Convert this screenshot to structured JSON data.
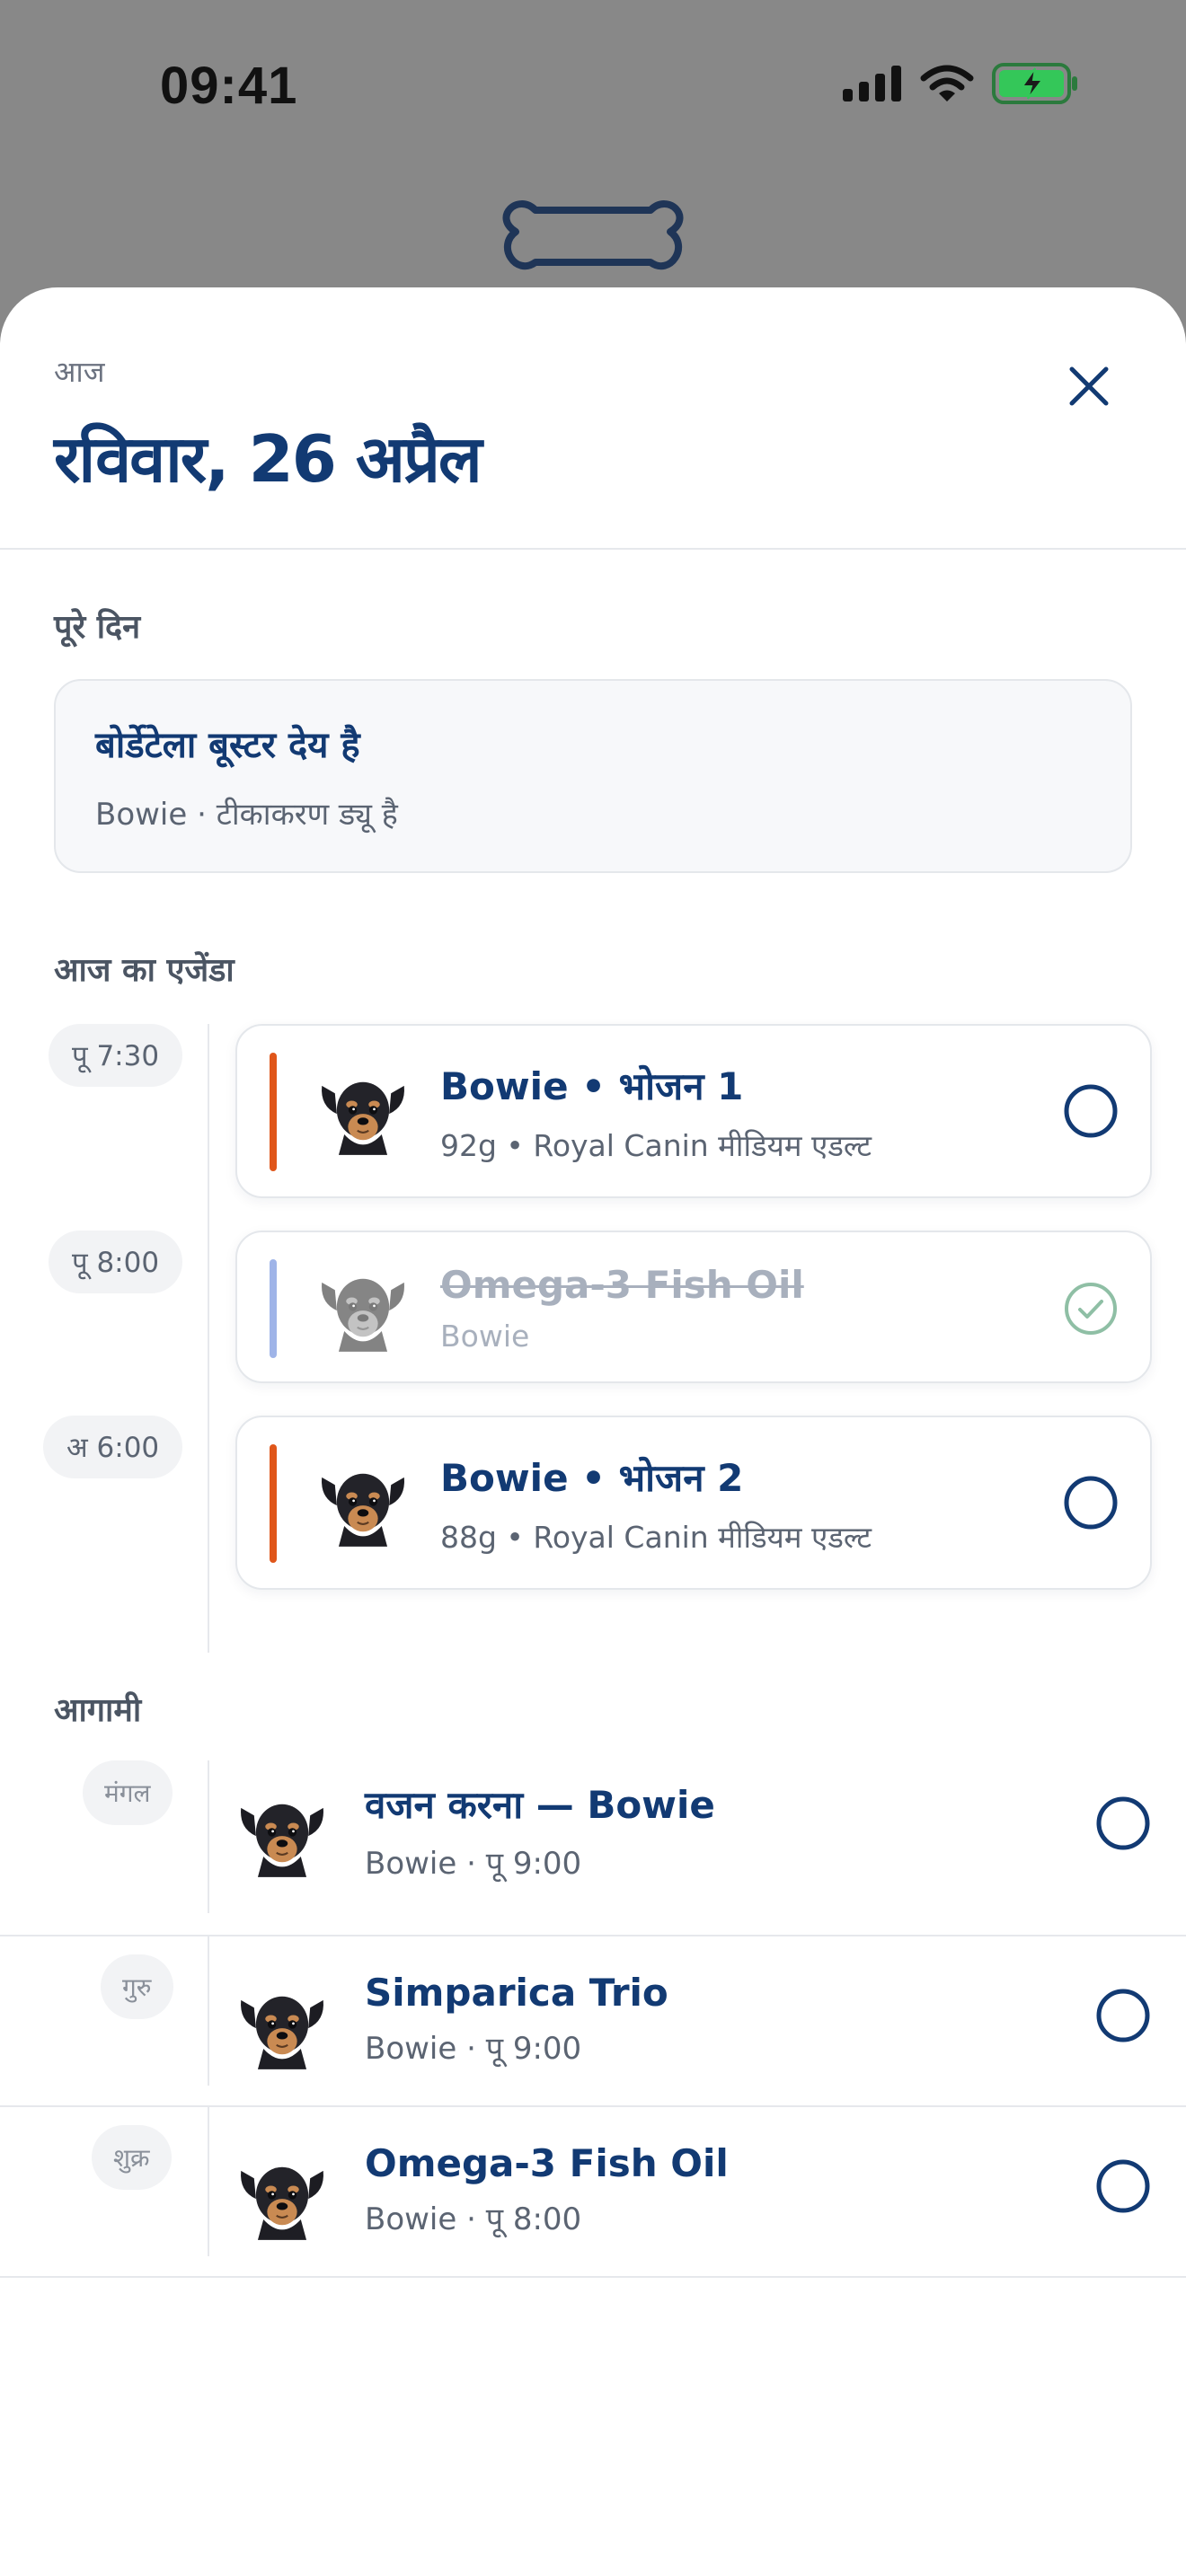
{
  "status_bar": {
    "time": "09:41"
  },
  "header": {
    "eyebrow": "आज",
    "date": "रविवार, 26 अप्रैल"
  },
  "all_day": {
    "label": "पूरे दिन",
    "card": {
      "title": "बोर्डेटेला बूस्टर देय है",
      "subtitle": "Bowie · टीकाकरण ड्यू है"
    }
  },
  "agenda": {
    "label": "आज का एजेंडा",
    "items": [
      {
        "time": "पू 7:30",
        "title": "Bowie • भोजन 1",
        "subtitle": "92g • Royal Canin मीडियम एडल्ट",
        "done": false,
        "accent": "#e0561a"
      },
      {
        "time": "पू 8:00",
        "title": "Omega-3 Fish Oil",
        "subtitle": "Bowie",
        "done": true,
        "accent": "#9fb4e8"
      },
      {
        "time": "अ 6:00",
        "title": "Bowie • भोजन 2",
        "subtitle": "88g • Royal Canin मीडियम एडल्ट",
        "done": false,
        "accent": "#e0561a"
      }
    ]
  },
  "upcoming": {
    "label": "आगामी",
    "items": [
      {
        "day": "मंगल",
        "title": "वजन करना — Bowie",
        "subtitle": "Bowie · पू 9:00"
      },
      {
        "day": "गुरु",
        "title": "Simparica Trio",
        "subtitle": "Bowie · पू 9:00"
      },
      {
        "day": "शुक्र",
        "title": "Omega-3 Fish Oil",
        "subtitle": "Bowie · पू 8:00"
      }
    ]
  },
  "colors": {
    "navy": "#123a73",
    "accent_meal": "#e0561a",
    "accent_supplement": "#9fb4e8",
    "done_check": "#8fbfa5",
    "battery_green": "#34c759"
  },
  "icons": [
    "cellular-icon",
    "wifi-icon",
    "battery-charging-icon",
    "bone-icon",
    "close-icon",
    "dog-avatar",
    "empty-circle-icon",
    "check-circle-icon"
  ]
}
